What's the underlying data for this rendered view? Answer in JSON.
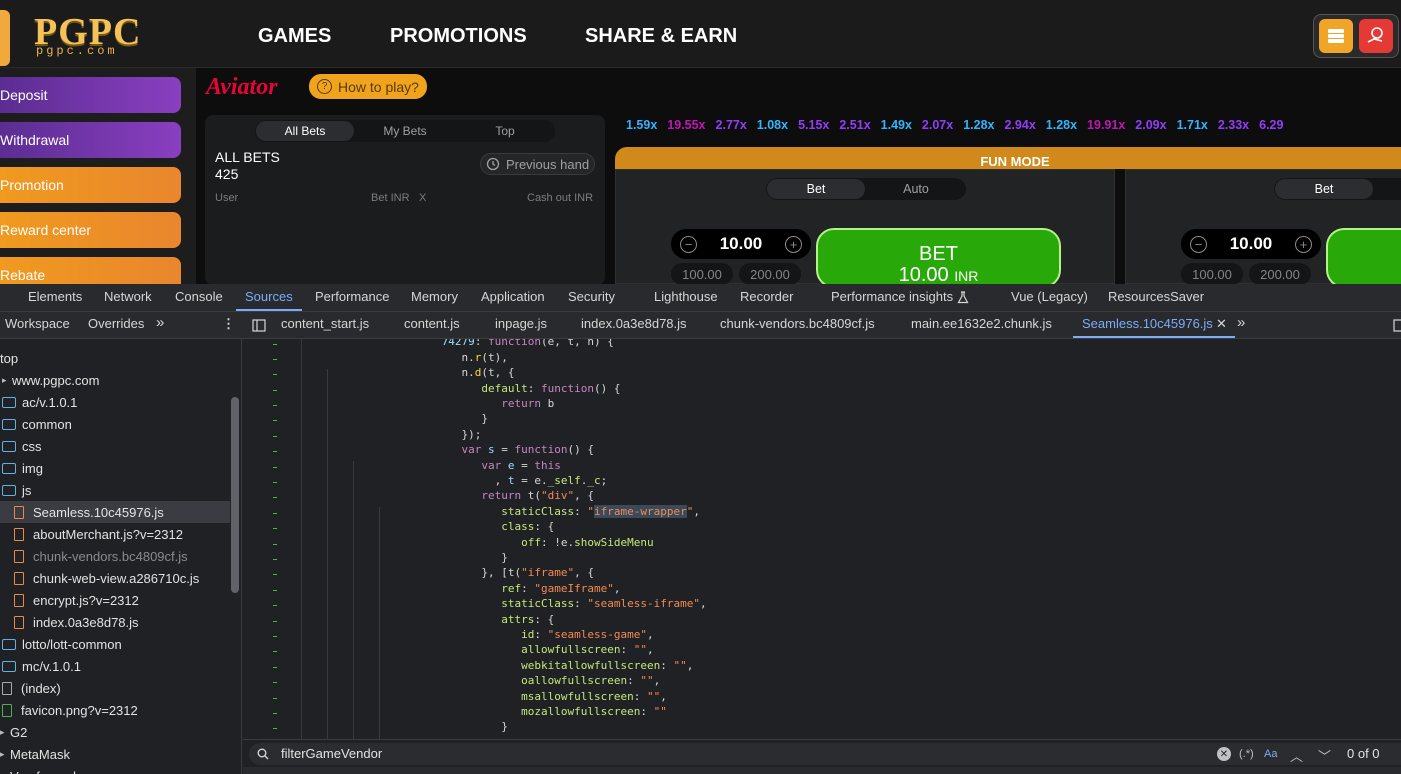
{
  "site": {
    "logo": "PGPC",
    "logo_sub": "pgpc.com",
    "nav": [
      "GAMES",
      "PROMOTIONS",
      "SHARE & EARN"
    ],
    "header_icons": [
      "coin-stack-icon",
      "gift-hand-icon"
    ],
    "colors": {
      "logo_gold": "#f4c25a",
      "purple_btn": "#7a37b0",
      "orange_btn": "#ee9325"
    }
  },
  "sidebar": {
    "items": [
      "Deposit",
      "Withdrawal",
      "Promotion",
      "Reward center",
      "Rebate"
    ]
  },
  "game": {
    "title": "Aviator",
    "how_to_play": "How to play?",
    "bets_tabs": [
      "All Bets",
      "My Bets",
      "Top"
    ],
    "all_bets_label": "ALL BETS",
    "all_bets_count": "425",
    "previous_hand": "Previous hand",
    "columns": {
      "user": "User",
      "bet": "Bet INR",
      "x": "X",
      "cashout": "Cash out INR"
    },
    "multipliers": [
      {
        "v": "1.59x",
        "c": "#34b4ff"
      },
      {
        "v": "19.55x",
        "c": "#c017b4"
      },
      {
        "v": "2.77x",
        "c": "#913ef8"
      },
      {
        "v": "1.08x",
        "c": "#34b4ff"
      },
      {
        "v": "5.15x",
        "c": "#913ef8"
      },
      {
        "v": "2.51x",
        "c": "#913ef8"
      },
      {
        "v": "1.49x",
        "c": "#34b4ff"
      },
      {
        "v": "2.07x",
        "c": "#913ef8"
      },
      {
        "v": "1.28x",
        "c": "#34b4ff"
      },
      {
        "v": "2.94x",
        "c": "#913ef8"
      },
      {
        "v": "1.28x",
        "c": "#34b4ff"
      },
      {
        "v": "19.91x",
        "c": "#c017b4"
      },
      {
        "v": "2.09x",
        "c": "#913ef8"
      },
      {
        "v": "1.71x",
        "c": "#34b4ff"
      },
      {
        "v": "2.33x",
        "c": "#913ef8"
      },
      {
        "v": "6.29",
        "c": "#913ef8"
      }
    ],
    "fun_mode": "FUN MODE",
    "panel1": {
      "tabs": [
        "Bet",
        "Auto"
      ],
      "amount": "10.00",
      "quick": [
        "100.00",
        "200.00"
      ],
      "bet_label": "BET",
      "bet_amount": "10.00",
      "bet_currency": "INR"
    },
    "panel2": {
      "tabs": [
        "Bet"
      ],
      "amount": "10.00",
      "quick": [
        "100.00",
        "200.00"
      ]
    }
  },
  "devtools": {
    "tabs": [
      "Elements",
      "Network",
      "Console",
      "Sources",
      "Performance",
      "Memory",
      "Application",
      "Security",
      "Lighthouse",
      "Recorder",
      "Performance insights",
      "Vue (Legacy)",
      "ResourcesSaver"
    ],
    "active_tab": "Sources",
    "nav_tabs": [
      "Workspace",
      "Overrides"
    ],
    "file_tabs": [
      "content_start.js",
      "content.js",
      "inpage.js",
      "index.0a3e8d78.js",
      "chunk-vendors.bc4809cf.js",
      "main.ee1632e2.chunk.js",
      "Seamless.10c45976.js"
    ],
    "active_file": "Seamless.10c45976.js",
    "tree": [
      {
        "label": "top",
        "type": "none",
        "indent": 0
      },
      {
        "label": "www.pgpc.com",
        "type": "none",
        "indent": 1
      },
      {
        "label": "ac/v.1.0.1",
        "type": "folder",
        "indent": 1
      },
      {
        "label": "common",
        "type": "folder",
        "indent": 1
      },
      {
        "label": "css",
        "type": "folder",
        "indent": 1
      },
      {
        "label": "img",
        "type": "folder",
        "indent": 1
      },
      {
        "label": "js",
        "type": "folder",
        "indent": 1
      },
      {
        "label": "Seamless.10c45976.js",
        "type": "file",
        "indent": 2,
        "selected": true
      },
      {
        "label": "aboutMerchant.js?v=2312",
        "type": "file",
        "indent": 2
      },
      {
        "label": "chunk-vendors.bc4809cf.js",
        "type": "file-dim",
        "indent": 2
      },
      {
        "label": "chunk-web-view.a286710c.js",
        "type": "file",
        "indent": 2
      },
      {
        "label": "encrypt.js?v=2312",
        "type": "file",
        "indent": 2
      },
      {
        "label": "index.0a3e8d78.js",
        "type": "file",
        "indent": 2
      },
      {
        "label": "lotto/lott-common",
        "type": "folder",
        "indent": 1
      },
      {
        "label": "mc/v.1.0.1",
        "type": "folder",
        "indent": 1
      },
      {
        "label": "(index)",
        "type": "plain",
        "indent": 1
      },
      {
        "label": "favicon.png?v=2312",
        "type": "green",
        "indent": 1
      },
      {
        "label": "G2",
        "type": "none",
        "indent": 0
      },
      {
        "label": "MetaMask",
        "type": "none",
        "indent": 0
      },
      {
        "label": "Vue force dev",
        "type": "none",
        "indent": 0
      }
    ],
    "search": {
      "query": "filterGameVendor",
      "result": "0 of 0",
      "regex": "(.*)",
      "case": "Aa"
    }
  }
}
